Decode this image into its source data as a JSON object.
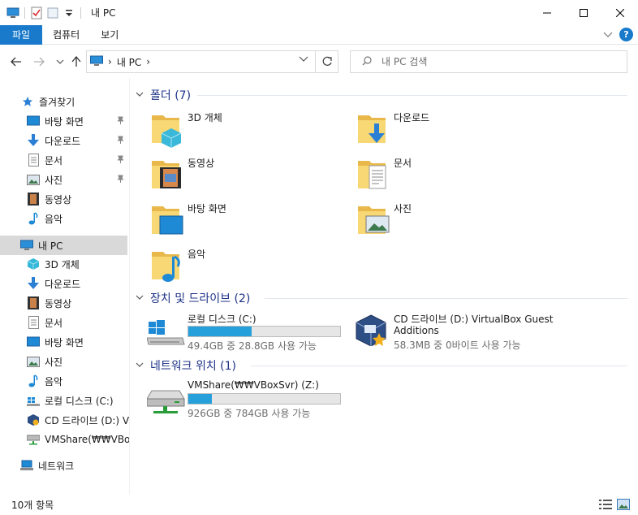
{
  "window": {
    "title": "내 PC",
    "minimize_glyph": "─",
    "maximize_glyph": "☐",
    "close_glyph": "✕"
  },
  "ribbon": {
    "tabs": [
      "파일",
      "컴퓨터",
      "보기"
    ],
    "expand_glyph": "∨",
    "help_glyph": "?"
  },
  "address": {
    "crumb": "내 PC",
    "separator": "›",
    "back_glyph": "←",
    "forward_glyph": "→",
    "recent_glyph": "⌄",
    "up_glyph": "↑",
    "dropdown_glyph": "∨",
    "refresh_glyph": "↻"
  },
  "search": {
    "placeholder": "내 PC 검색",
    "icon_glyph": "⌕"
  },
  "navpane": {
    "quick_access": "즐겨찾기",
    "quick_items": [
      {
        "label": "바탕 화면",
        "icon": "desktop-icon",
        "pinned": true
      },
      {
        "label": "다운로드",
        "icon": "download-icon",
        "pinned": true
      },
      {
        "label": "문서",
        "icon": "documents-icon",
        "pinned": true
      },
      {
        "label": "사진",
        "icon": "pictures-icon",
        "pinned": true
      },
      {
        "label": "동영상",
        "icon": "videos-icon",
        "pinned": false
      },
      {
        "label": "음악",
        "icon": "music-icon",
        "pinned": false
      }
    ],
    "this_pc": "내 PC",
    "pc_items": [
      {
        "label": "3D 개체",
        "icon": "3d-objects-icon"
      },
      {
        "label": "다운로드",
        "icon": "download-icon"
      },
      {
        "label": "동영상",
        "icon": "videos-icon"
      },
      {
        "label": "문서",
        "icon": "documents-icon"
      },
      {
        "label": "바탕 화면",
        "icon": "desktop-icon"
      },
      {
        "label": "사진",
        "icon": "pictures-icon"
      },
      {
        "label": "음악",
        "icon": "music-icon"
      },
      {
        "label": "로컬 디스크 (C:)",
        "icon": "local-disk-icon"
      },
      {
        "label": "CD 드라이브 (D:) V",
        "icon": "cd-drive-icon"
      },
      {
        "label": "VMShare(₩₩VBoxS",
        "icon": "network-drive-icon"
      }
    ],
    "network": "네트워크",
    "pin_glyph": "📌"
  },
  "content": {
    "folders_header": "폴더 (7)",
    "folders": [
      {
        "label": "3D 개체",
        "icon": "3d-objects-icon"
      },
      {
        "label": "다운로드",
        "icon": "download-icon"
      },
      {
        "label": "동영상",
        "icon": "videos-icon"
      },
      {
        "label": "문서",
        "icon": "documents-icon"
      },
      {
        "label": "바탕 화면",
        "icon": "desktop-icon"
      },
      {
        "label": "사진",
        "icon": "pictures-icon"
      },
      {
        "label": "음악",
        "icon": "music-icon"
      }
    ],
    "devices_header": "장치 및 드라이브 (2)",
    "drives": [
      {
        "name": "로컬 디스크 (C:)",
        "info": "49.4GB 중 28.8GB 사용 가능",
        "used_fraction": 0.417,
        "icon": "local-disk-icon"
      },
      {
        "name": "CD 드라이브 (D:) VirtualBox Guest",
        "name2": "Additions",
        "info": "58.3MB 중 0바이트 사용 가능",
        "icon": "virtualbox-cd-icon"
      }
    ],
    "network_header": "네트워크 위치 (1)",
    "network_drives": [
      {
        "name": "VMShare(₩₩VBoxSvr) (Z:)",
        "info": "926GB 중 784GB 사용 가능",
        "used_fraction": 0.153,
        "icon": "network-drive-icon"
      }
    ]
  },
  "status": {
    "count": "10개 항목"
  },
  "colors": {
    "accent": "#1979ca",
    "group_header": "#1e3287",
    "bar_fill": "#26a0da",
    "folder_yellow": "#f8d775"
  }
}
